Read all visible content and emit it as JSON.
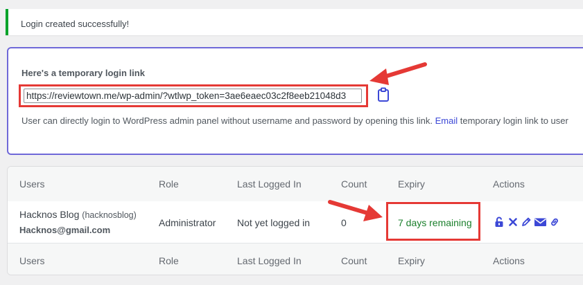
{
  "notice": {
    "message": "Login created successfully!"
  },
  "login_box": {
    "heading": "Here's a temporary login link",
    "link_value": "https://reviewtown.me/wp-admin/?wtlwp_token=3ae6eaec03c2f8eeb21048d3",
    "desc_before": "User can directly login to WordPress admin panel without username and password by opening this link. ",
    "desc_link": "Email",
    "desc_after": " temporary login link to user"
  },
  "table": {
    "headers": {
      "users": "Users",
      "role": "Role",
      "last_logged_in": "Last Logged In",
      "count": "Count",
      "expiry": "Expiry",
      "actions": "Actions"
    },
    "row": {
      "name": "Hacknos Blog",
      "username": "(hacknosblog)",
      "email": "Hacknos@gmail.com",
      "role": "Administrator",
      "last_logged_in": "Not yet logged in",
      "count": "0",
      "expiry": "7 days remaining"
    }
  },
  "icons": {
    "clipboard": "clipboard-icon",
    "unlock": "unlock-icon",
    "delete": "close-icon",
    "edit": "pencil-icon",
    "email": "envelope-icon",
    "link": "link-icon"
  },
  "colors": {
    "accent": "#3c48d6",
    "success": "#00a32a",
    "highlight": "#e53935",
    "expiry": "#1a7f2b",
    "box_border": "#6f68d8"
  }
}
